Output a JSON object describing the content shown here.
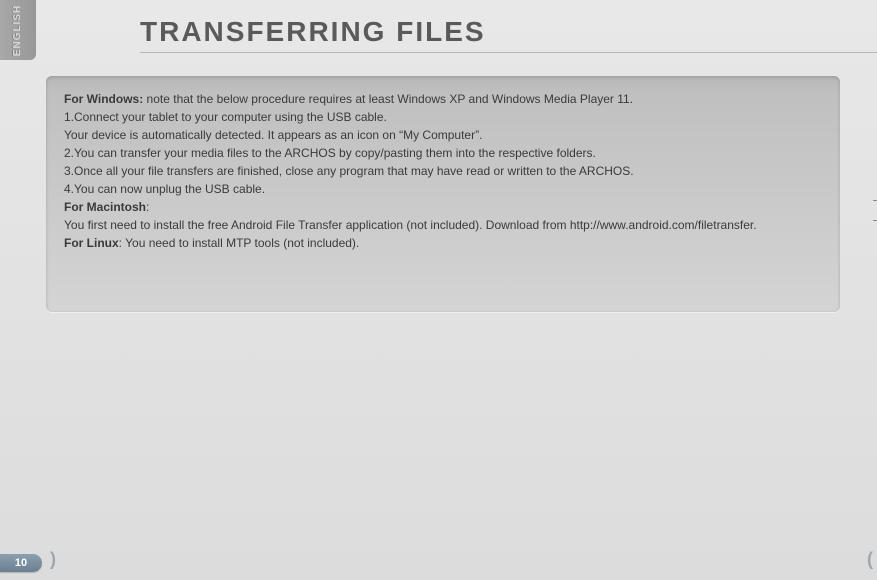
{
  "sidebar": {
    "language": "ENGLISH"
  },
  "page": {
    "title": "TRANSFERRING FILES",
    "number": "10"
  },
  "content": {
    "win_heading": "For Windows:",
    "win_intro": " note that the below procedure requires at least Windows XP and Windows Media Player 11.",
    "step1": "1.Connect your tablet to your computer using the USB cable.",
    "detected": "Your device is automatically detected. It appears as an icon on “My Computer”.",
    "step2": "2.You can transfer your media files to the ARCHOS by copy/pasting them into the respective folders.",
    "step3": "3.Once all your file transfers are finished, close any program that may have read or written to the ARCHOS.",
    "step4": "4.You can now unplug the USB cable.",
    "mac_heading": "For Macintosh",
    "mac_colon": ":",
    "mac_text": "You first need to install the free Android File Transfer application (not included). Download from http://www.android.com/filetransfer.",
    "linux_heading": "For Linux",
    "linux_text": ": You need to install MTP tools (not included)."
  }
}
